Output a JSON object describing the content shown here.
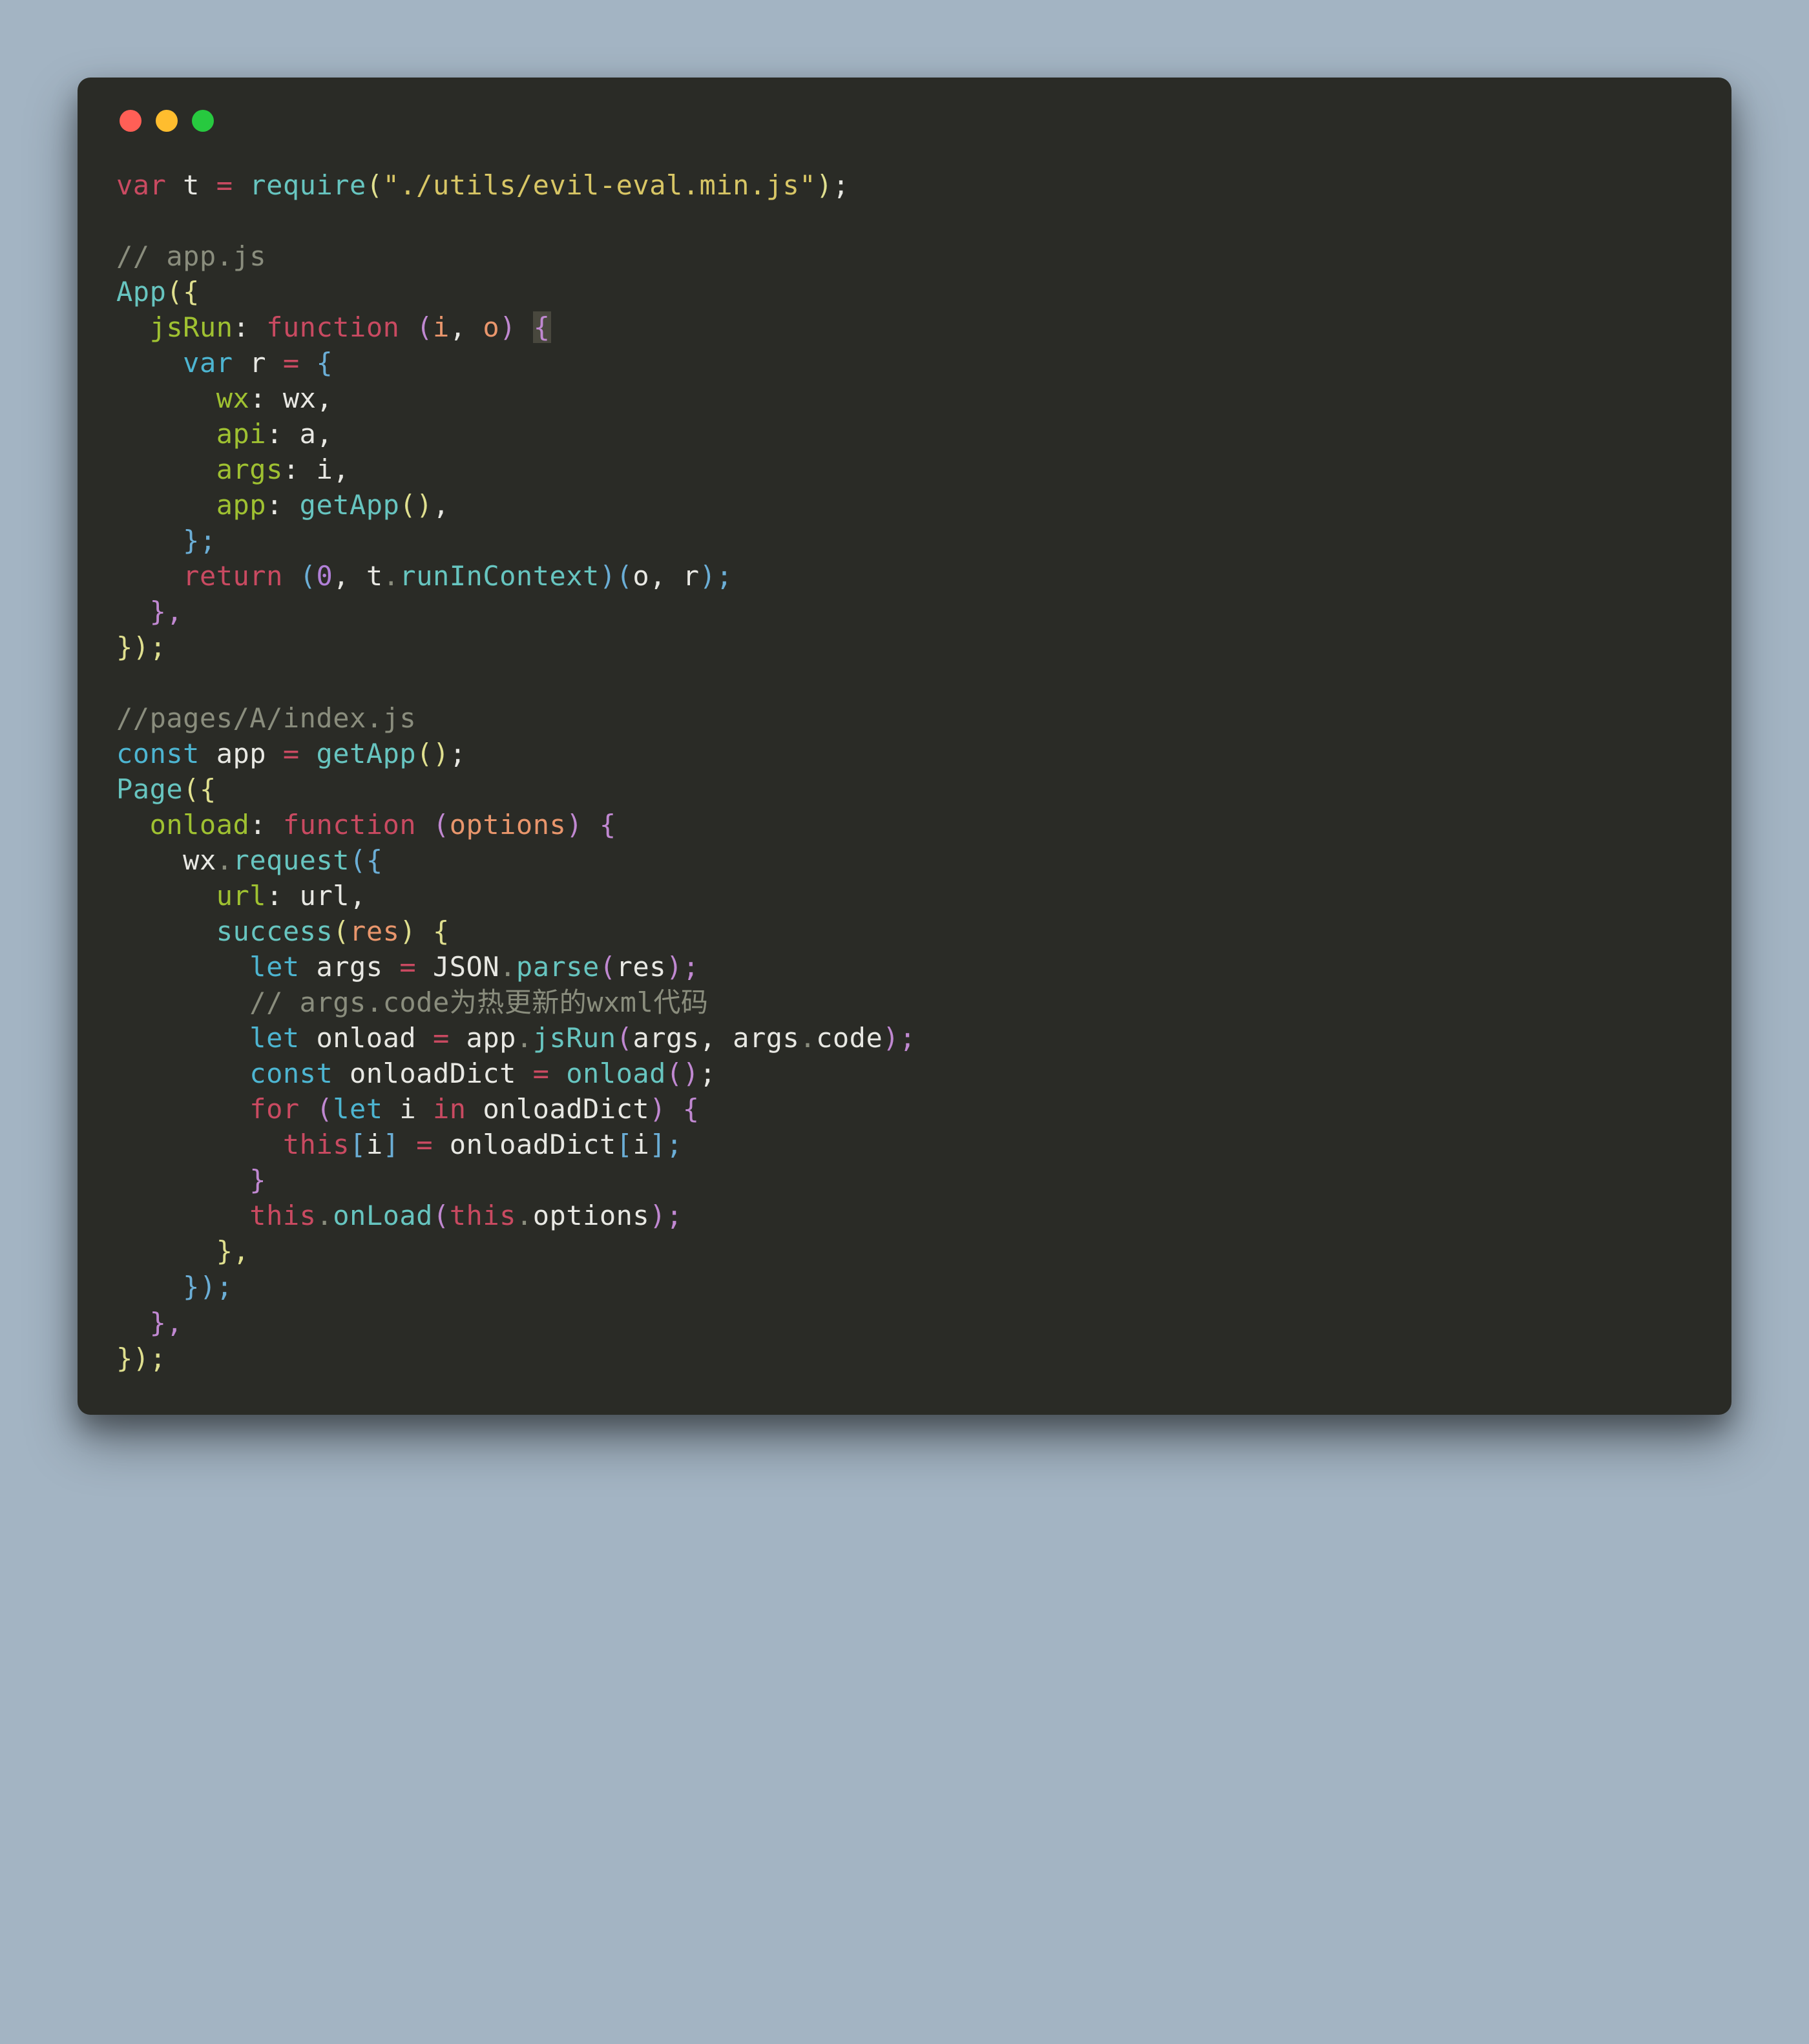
{
  "window": {
    "trafficLights": [
      "red",
      "yellow",
      "green"
    ]
  },
  "code": {
    "line1": {
      "var": "var",
      "t": " t ",
      "eq": "=",
      "require": " require",
      "open": "(",
      "str": "\"./utils/evil-eval.min.js\"",
      "close": ")",
      "semi": ";"
    },
    "line3": {
      "comment": "// app.js"
    },
    "line4": {
      "app": "App",
      "open": "({"
    },
    "line5": {
      "indent": "  ",
      "prop": "jsRun",
      "colon": ":",
      "func": " function ",
      "open": "(",
      "i": "i",
      "comma": ", ",
      "o": "o",
      "close": ") ",
      "brace": "{"
    },
    "line6": {
      "indent": "    ",
      "var": "var",
      "r": " r ",
      "eq": "=",
      "brace": " {"
    },
    "line7": {
      "indent": "      ",
      "prop": "wx",
      "colon": ":",
      "val": " wx,"
    },
    "line8": {
      "indent": "      ",
      "prop": "api",
      "colon": ":",
      "val": " a,"
    },
    "line9": {
      "indent": "      ",
      "prop": "args",
      "colon": ":",
      "val": " i,"
    },
    "line10": {
      "indent": "      ",
      "prop": "app",
      "colon": ":",
      "call": " getApp",
      "parens": "()",
      "comma": ","
    },
    "line11": {
      "indent": "    ",
      "close": "};"
    },
    "line12": {
      "indent": "    ",
      "return": "return",
      "open": " (",
      "zero": "0",
      "comma": ", t",
      "dot": ".",
      "method": "runInContext",
      "close": ")(",
      "args": "o, r",
      "close2": ");"
    },
    "line13": {
      "indent": "  ",
      "close": "},"
    },
    "line14": {
      "close": "});"
    },
    "line16": {
      "comment": "//pages/A/index.js"
    },
    "line17": {
      "const": "const",
      "app": " app ",
      "eq": "=",
      "call": " getApp",
      "parens": "()",
      "semi": ";"
    },
    "line18": {
      "page": "Page",
      "open": "({"
    },
    "line19": {
      "indent": "  ",
      "prop": "onload",
      "colon": ":",
      "func": " function ",
      "open": "(",
      "arg": "options",
      "close": ") {"
    },
    "line20": {
      "indent": "    ",
      "wx": "wx",
      "dot": ".",
      "method": "request",
      "open": "({"
    },
    "line21": {
      "indent": "      ",
      "prop": "url",
      "colon": ":",
      "val": " url,"
    },
    "line22": {
      "indent": "      ",
      "method": "success",
      "open": "(",
      "arg": "res",
      "close": ") {"
    },
    "line23": {
      "indent": "        ",
      "let": "let",
      "args": " args ",
      "eq": "=",
      "json": " JSON",
      "dot": ".",
      "parse": "parse",
      "open": "(",
      "res": "res",
      "close": ");"
    },
    "line24": {
      "indent": "        ",
      "comment": "// args.code为热更新的wxml代码"
    },
    "line25": {
      "indent": "        ",
      "let": "let",
      "onload": " onload ",
      "eq": "=",
      "app": " app",
      "dot": ".",
      "method": "jsRun",
      "open": "(",
      "args1": "args, args",
      "dot2": ".",
      "code": "code",
      "close": ");"
    },
    "line26": {
      "indent": "        ",
      "const": "const",
      "dict": " onloadDict ",
      "eq": "=",
      "call": " onload",
      "parens": "()",
      "semi": ";"
    },
    "line27": {
      "indent": "        ",
      "for": "for",
      "open": " (",
      "let": "let",
      "i": " i ",
      "in": "in",
      "dict": " onloadDict",
      "close": ") {"
    },
    "line28": {
      "indent": "          ",
      "this": "this",
      "open": "[",
      "i": "i",
      "close": "] ",
      "eq": "=",
      "dict": " onloadDict",
      "open2": "[",
      "i2": "i",
      "close2": "];"
    },
    "line29": {
      "indent": "        ",
      "close": "}"
    },
    "line30": {
      "indent": "        ",
      "this": "this",
      "dot": ".",
      "method": "onLoad",
      "open": "(",
      "this2": "this",
      "dot2": ".",
      "prop": "options",
      "close": ");"
    },
    "line31": {
      "indent": "      ",
      "close": "},"
    },
    "line32": {
      "indent": "    ",
      "close": "});"
    },
    "line33": {
      "indent": "  ",
      "close": "},"
    },
    "line34": {
      "close": "});"
    }
  }
}
